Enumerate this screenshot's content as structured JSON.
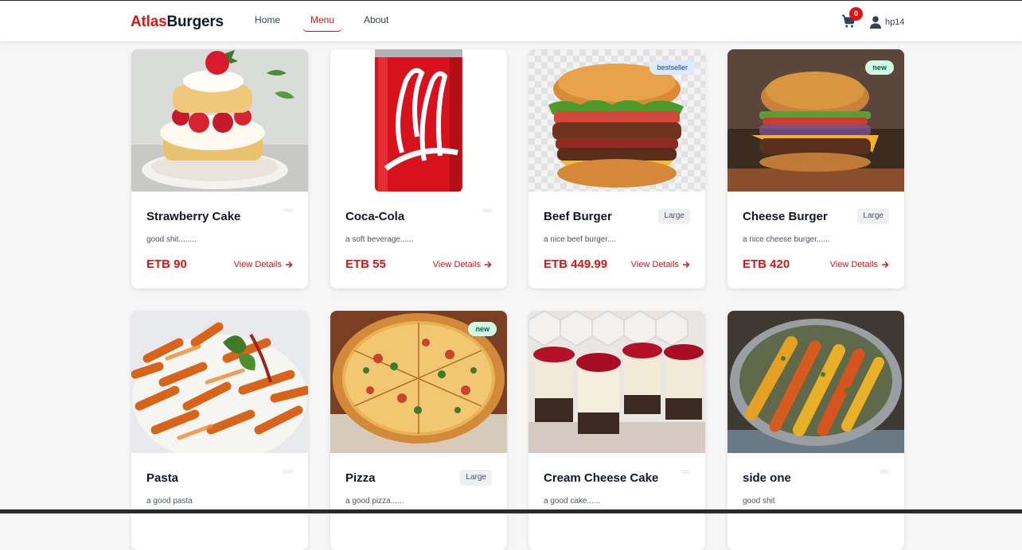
{
  "brand": {
    "part1": "Atlas",
    "part2": "Burgers"
  },
  "nav": {
    "home": "Home",
    "menu": "Menu",
    "about": "About"
  },
  "cart": {
    "count": "0"
  },
  "user": {
    "name": "hp14"
  },
  "colors": {
    "accent": "#dc1414",
    "bestseller_bg": "#dbeafe",
    "new_bg": "#d1fae5"
  },
  "details_label": "View Details",
  "products": [
    {
      "name": "Strawberry Cake",
      "desc": "good shit........",
      "price": "ETB 90",
      "size": "",
      "badge": ""
    },
    {
      "name": "Coca-Cola",
      "desc": "a soft beverage......",
      "price": "ETB 55",
      "size": "",
      "badge": ""
    },
    {
      "name": "Beef Burger",
      "desc": "a nice beef burger....",
      "price": "ETB 449.99",
      "size": "Large",
      "badge": "bestseller"
    },
    {
      "name": "Cheese Burger",
      "desc": "a nice cheese burger......",
      "price": "ETB 420",
      "size": "Large",
      "badge": "new"
    },
    {
      "name": "Pasta",
      "desc": "a good pasta",
      "price": "",
      "size": "",
      "badge": ""
    },
    {
      "name": "Pizza",
      "desc": "a good pizza......",
      "price": "",
      "size": "Large",
      "badge": "new"
    },
    {
      "name": "Cream Cheese Cake",
      "desc": "a good cake......",
      "price": "",
      "size": "",
      "badge": ""
    },
    {
      "name": "side one",
      "desc": "good shit",
      "price": "",
      "size": "",
      "badge": ""
    }
  ]
}
